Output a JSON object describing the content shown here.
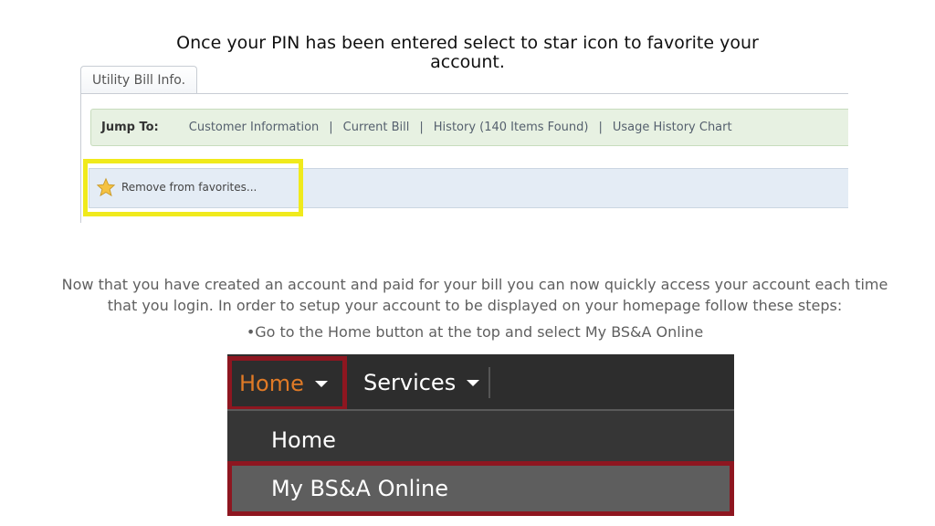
{
  "instruction": {
    "title": "Once your PIN has been entered select to star icon to favorite your account."
  },
  "utility_panel": {
    "tab_label": "Utility Bill Info.",
    "jump_label": "Jump To:",
    "links": [
      "Customer Information",
      "Current Bill",
      "History (140 Items Found)",
      "Usage History Chart"
    ],
    "separator": "|",
    "favorite_button": "Remove from favorites...",
    "highlight_color": "#f0ea1c",
    "star_color": "#f5c242"
  },
  "description": {
    "paragraph": "Now that you have created an account and paid for your bill you can now quickly access your account each time that you login. In order to setup your account to be displayed on your homepage follow these steps:",
    "bullet": "•Go to the Home button at the top and select My BS&A Online"
  },
  "nav_menu": {
    "home_label": "Home",
    "services_label": "Services",
    "dropdown_items": [
      "Home",
      "My BS&A Online"
    ],
    "highlight_color": "#8e1620",
    "home_text_color": "#e07a26"
  }
}
